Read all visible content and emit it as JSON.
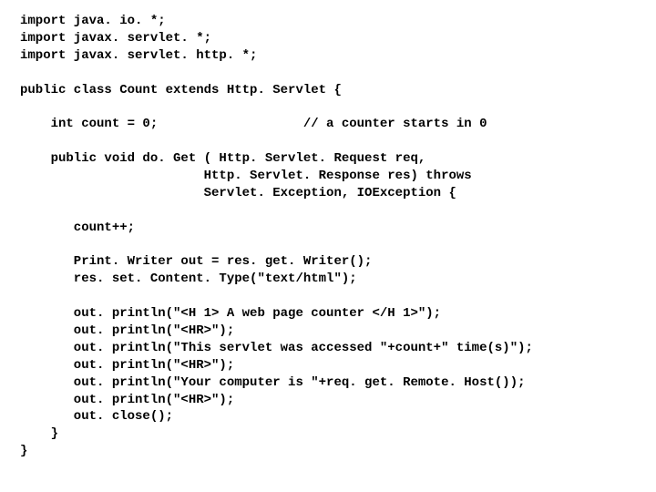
{
  "code": {
    "lines": [
      "import java. io. *;",
      "import javax. servlet. *;",
      "import javax. servlet. http. *;",
      "",
      "public class Count extends Http. Servlet {",
      "",
      "    int count = 0;                   // a counter starts in 0",
      "",
      "    public void do. Get ( Http. Servlet. Request req,",
      "                        Http. Servlet. Response res) throws",
      "                        Servlet. Exception, IOException {",
      "",
      "       count++;",
      "",
      "       Print. Writer out = res. get. Writer();",
      "       res. set. Content. Type(\"text/html\");",
      "",
      "       out. println(\"<H 1> A web page counter </H 1>\");",
      "       out. println(\"<HR>\");",
      "       out. println(\"This servlet was accessed \"+count+\" time(s)\");",
      "       out. println(\"<HR>\");",
      "       out. println(\"Your computer is \"+req. get. Remote. Host());",
      "       out. println(\"<HR>\");",
      "       out. close();",
      "    }",
      "}"
    ]
  }
}
